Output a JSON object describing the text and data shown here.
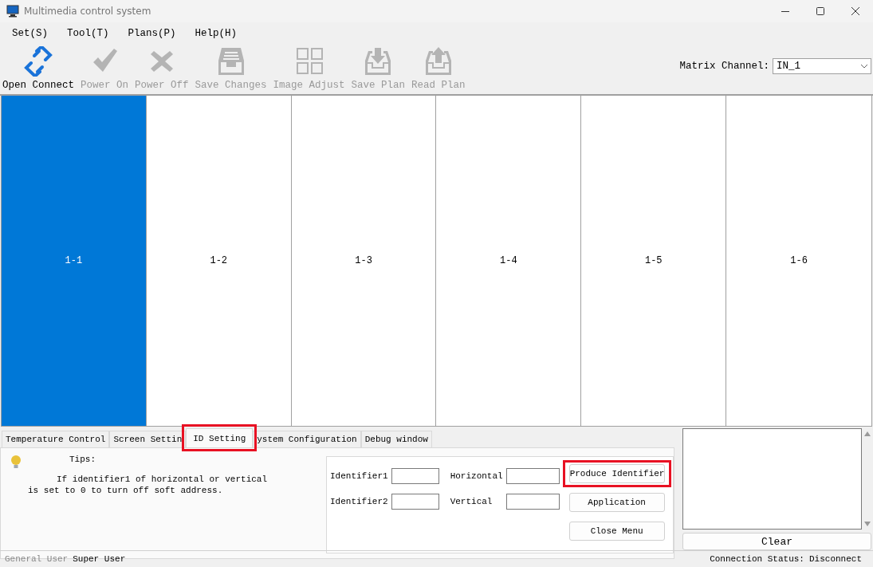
{
  "window": {
    "title": "Multimedia control system"
  },
  "menu": [
    "Set(S)",
    "Tool(T)",
    "Plans(P)",
    "Help(H)"
  ],
  "toolbar": {
    "buttons": [
      {
        "label": "Open Connect",
        "disabled": false
      },
      {
        "label": "Power On",
        "disabled": true
      },
      {
        "label": "Power Off",
        "disabled": true
      },
      {
        "label": "Save Changes",
        "disabled": true
      },
      {
        "label": "Image Adjust",
        "disabled": true
      },
      {
        "label": "Save Plan",
        "disabled": true
      },
      {
        "label": "Read Plan",
        "disabled": true
      }
    ],
    "matrix_channel": {
      "label": "Matrix Channel:",
      "value": "IN_1"
    }
  },
  "screens": [
    {
      "label": "1-1",
      "selected": true
    },
    {
      "label": "1-2",
      "selected": false
    },
    {
      "label": "1-3",
      "selected": false
    },
    {
      "label": "1-4",
      "selected": false
    },
    {
      "label": "1-5",
      "selected": false
    },
    {
      "label": "1-6",
      "selected": false
    }
  ],
  "tabs": [
    {
      "label": "Temperature Control",
      "selected": false,
      "highlighted": false
    },
    {
      "label": "Screen Settin",
      "selected": false,
      "highlighted": false
    },
    {
      "label": "ID Setting",
      "selected": true,
      "highlighted": true
    },
    {
      "label": "ystem Configuration",
      "selected": false,
      "highlighted": false
    },
    {
      "label": "Debug window",
      "selected": false,
      "highlighted": false
    }
  ],
  "tips": {
    "title": "Tips:",
    "text": "If identifier1 of horizontal or vertical is set to 0 to turn off soft address."
  },
  "id_form": {
    "fields": [
      "Identifier1",
      "Horizontal",
      "Identifier2",
      "Vertical"
    ],
    "buttons": [
      {
        "label": "Produce Identifier",
        "highlighted": true
      },
      {
        "label": "Application",
        "highlighted": false
      },
      {
        "label": "Close Menu",
        "highlighted": false
      }
    ]
  },
  "log": {
    "clear_button": "Clear"
  },
  "status_bar": {
    "user_label": "General User",
    "user": "Super User",
    "connection_label": "Connection Status:",
    "connection": "Disconnect"
  }
}
